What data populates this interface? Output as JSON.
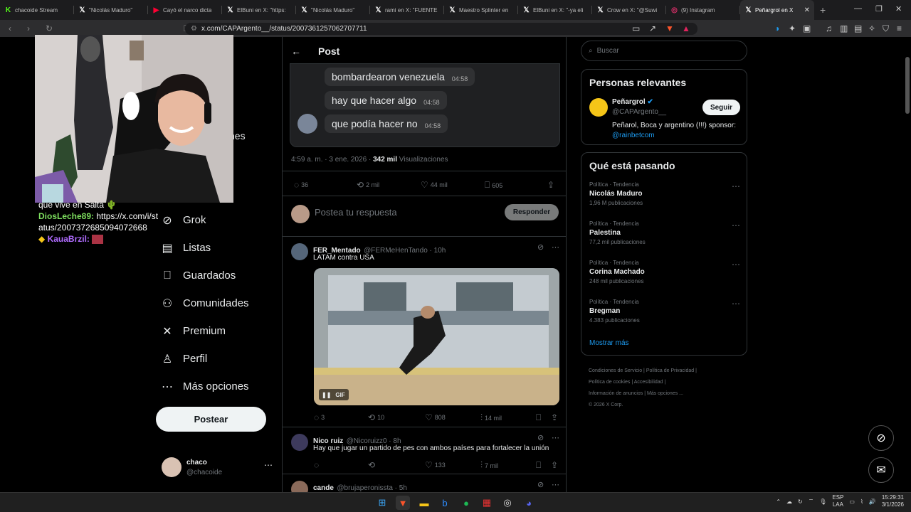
{
  "browser": {
    "tabs": [
      {
        "title": "chacoide Stream",
        "icon": "kick-icon",
        "color": "#53fc18"
      },
      {
        "title": "\"Nicolás Maduro\"",
        "icon": "x-icon",
        "color": "#ffffff"
      },
      {
        "title": "Cayó el narco dicta",
        "icon": "youtube-icon",
        "color": "#ff0033"
      },
      {
        "title": "ElBuni en X: \"https:",
        "icon": "x-icon",
        "color": "#ffffff"
      },
      {
        "title": "\"Nicolás Maduro\"",
        "icon": "x-icon",
        "color": "#ffffff"
      },
      {
        "title": "rami en X: \"FUENTE",
        "icon": "x-icon",
        "color": "#ffffff"
      },
      {
        "title": "Maestro Splinter en",
        "icon": "x-icon",
        "color": "#ffffff"
      },
      {
        "title": "ElBuni en X: \"-ya eli",
        "icon": "x-icon",
        "color": "#ffffff"
      },
      {
        "title": "Crow en X: \"@Suwi",
        "icon": "x-icon",
        "color": "#ffffff"
      },
      {
        "title": "(9) Instagram",
        "icon": "instagram-icon",
        "color": "#e1306c"
      },
      {
        "title": "Peñargrol en X",
        "icon": "x-icon",
        "color": "#ffffff",
        "active": true
      }
    ],
    "url": "x.com/CAPArgento__/status/2007361257062707711"
  },
  "overlay": {
    "partial_text": "nes",
    "chat": [
      {
        "user": "",
        "text": "que vive en Salta"
      },
      {
        "user": "DiosLeche89:",
        "text": " https://x.com/i/status/2007372685094072668",
        "color": "#7dde5e"
      },
      {
        "user": "KauaBrzil:",
        "text": "",
        "color": "#b06cff"
      }
    ]
  },
  "leftnav": {
    "items": [
      {
        "label": "Grok",
        "icon": "grok-icon",
        "glyph": "⊘"
      },
      {
        "label": "Listas",
        "icon": "list-icon",
        "glyph": "▤"
      },
      {
        "label": "Guardados",
        "icon": "bookmark-icon",
        "glyph": "⎕"
      },
      {
        "label": "Comunidades",
        "icon": "communities-icon",
        "glyph": "⚇"
      },
      {
        "label": "Premium",
        "icon": "x-premium-icon",
        "glyph": "✕"
      },
      {
        "label": "Perfil",
        "icon": "profile-icon",
        "glyph": "♙"
      },
      {
        "label": "Más opciones",
        "icon": "more-options-icon",
        "glyph": "⋯"
      }
    ],
    "post_button": "Postear",
    "account": {
      "name": "chaco",
      "handle": "@chacoide"
    }
  },
  "post": {
    "header": "Post",
    "messages": [
      {
        "text": "bombardearon venezuela",
        "time": "04:58"
      },
      {
        "text": "hay que hacer algo",
        "time": "04:58"
      },
      {
        "text": "que podía hacer no",
        "time": "04:58"
      }
    ],
    "timestamp": "4:59 a. m. · 3 ene. 2026 · ",
    "views_count": "342 mil",
    "views_label": " Visualizaciones",
    "stats": {
      "replies": "36",
      "reposts": "2 mil",
      "likes": "44 mil",
      "bookmarks": "605"
    },
    "reply_placeholder": "Postea tu respuesta",
    "reply_button": "Responder"
  },
  "replies": [
    {
      "name": "FER_Mentado",
      "handle": "@FERMeHenTando · 10h",
      "text": "LATAM contra USA",
      "gif_label": "GIF",
      "replies": "3",
      "reposts": "10",
      "likes": "808",
      "views": "14 mil"
    },
    {
      "name": "Nico ruiz",
      "handle": "@Nicoruizz0 · 8h",
      "text": "Hay que jugar un partido de pes con ambos países para fortalecer la unión",
      "replies": "",
      "reposts": "",
      "likes": "133",
      "views": "7 mil"
    },
    {
      "name": "cande",
      "handle": "@brujaperonissta · 5h",
      "text": ""
    }
  ],
  "right": {
    "search_placeholder": "Buscar",
    "relevant_title": "Personas relevantes",
    "profile": {
      "name": "Peñargrol",
      "handle": "@CAPArgento__",
      "follow": "Seguir",
      "bio": "Peñarol, Boca y argentino (!!!) sponsor: ",
      "bio_link": "@rainbetcom"
    },
    "trending_title": "Qué está pasando",
    "trends": [
      {
        "category": "Política · Tendencia",
        "name": "Nicolás Maduro",
        "count": "1,96 M publicaciones"
      },
      {
        "category": "Política · Tendencia",
        "name": "Palestina",
        "count": "77,2 mil publicaciones"
      },
      {
        "category": "Política · Tendencia",
        "name": "Corina Machado",
        "count": "248 mil publicaciones"
      },
      {
        "category": "Política · Tendencia",
        "name": "Bregman",
        "count": "4.383 publicaciones"
      }
    ],
    "show_more": "Mostrar más",
    "footer": [
      "Condiciones de Servicio",
      "Política de Privacidad",
      "Política de cookies",
      "Accesibilidad",
      "Información de anuncios",
      "Más opciones ...",
      "© 2026 X Corp."
    ]
  },
  "taskbar": {
    "lang": "ESP",
    "lang2": "LAA",
    "time": "15:29:31",
    "date": "3/1/2026"
  },
  "colors": {
    "accent": "#1d9bf0",
    "verified": "#1d9bf0"
  }
}
